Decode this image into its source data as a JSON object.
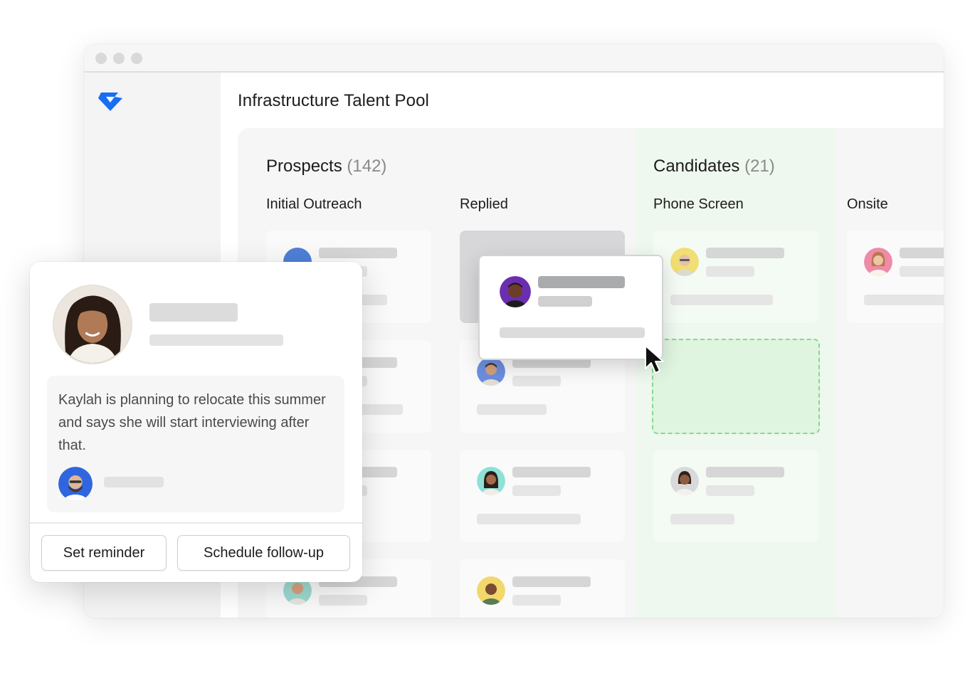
{
  "app": {
    "page_title": "Infrastructure Talent Pool",
    "colors": {
      "brand": "#1a6cf2",
      "candidates_column": "#eef8ee",
      "drop_zone_border": "#87d990"
    }
  },
  "board": {
    "groups": [
      {
        "name": "Prospects",
        "count": "(142)"
      },
      {
        "name": "Candidates",
        "count": "(21)"
      }
    ],
    "stages": [
      "Initial Outreach",
      "Replied",
      "Phone Screen",
      "Onsite"
    ]
  },
  "popup": {
    "note": "Kaylah is planning to relocate this summer and says she will start interviewing after that.",
    "buttons": {
      "set_reminder": "Set reminder",
      "schedule_follow_up": "Schedule follow-up"
    }
  }
}
